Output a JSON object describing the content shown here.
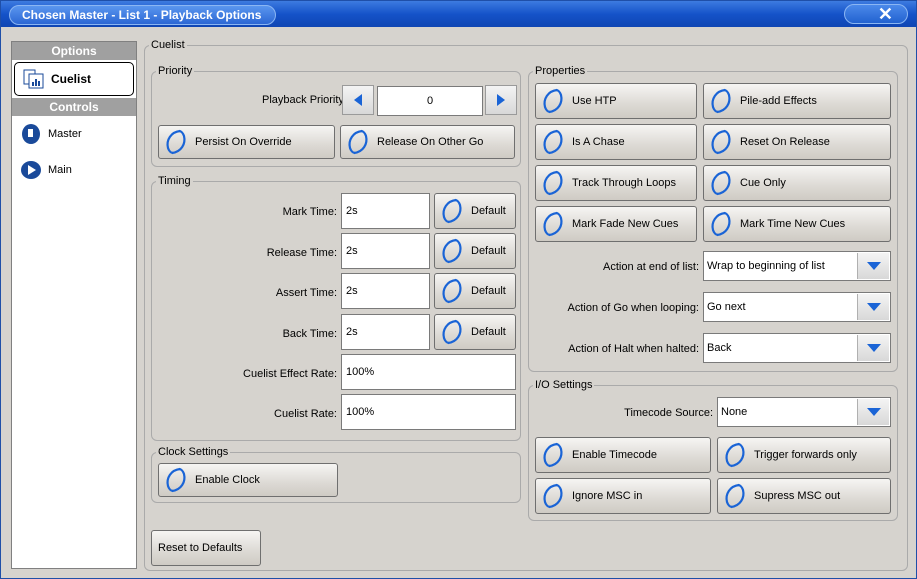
{
  "window": {
    "title": "Chosen Master - List 1 - Playback Options",
    "close_glyph": "✕"
  },
  "sidebar": {
    "options_header": "Options",
    "controls_header": "Controls",
    "items": [
      {
        "label": "Cuelist",
        "icon": "cuelist-icon"
      },
      {
        "label": "Master",
        "icon": "master-fader-icon"
      },
      {
        "label": "Main",
        "icon": "main-playback-icon"
      }
    ]
  },
  "cuelist": {
    "legend": "Cuelist",
    "priority": {
      "legend": "Priority",
      "playback_priority_label": "Playback Priority:",
      "playback_priority_value": "0",
      "persist_on_override": "Persist On Override",
      "release_on_other_go": "Release On Other Go"
    },
    "timing": {
      "legend": "Timing",
      "mark_time_label": "Mark Time:",
      "mark_time_value": "2s",
      "release_time_label": "Release Time:",
      "release_time_value": "2s",
      "assert_time_label": "Assert Time:",
      "assert_time_value": "2s",
      "back_time_label": "Back Time:",
      "back_time_value": "2s",
      "default_label": "Default",
      "effect_rate_label": "Cuelist Effect Rate:",
      "effect_rate_value": "100%",
      "cuelist_rate_label": "Cuelist Rate:",
      "cuelist_rate_value": "100%"
    },
    "clock": {
      "legend": "Clock Settings",
      "enable_clock": "Enable Clock"
    },
    "properties": {
      "legend": "Properties",
      "use_htp": "Use HTP",
      "pile_add_effects": "Pile-add Effects",
      "is_a_chase": "Is A Chase",
      "reset_on_release": "Reset On Release",
      "track_through_loops": "Track Through Loops",
      "cue_only": "Cue Only",
      "mark_fade_new_cues": "Mark Fade New Cues",
      "mark_time_new_cues": "Mark Time New Cues",
      "action_end_label": "Action at end of list:",
      "action_end_value": "Wrap to beginning of list",
      "action_go_label": "Action of Go when looping:",
      "action_go_value": "Go next",
      "action_halt_label": "Action of Halt when halted:",
      "action_halt_value": "Back"
    },
    "io": {
      "legend": "I/O Settings",
      "timecode_source_label": "Timecode Source:",
      "timecode_source_value": "None",
      "enable_timecode": "Enable Timecode",
      "trigger_forwards_only": "Trigger forwards only",
      "ignore_msc_in": "Ignore MSC in",
      "supress_msc_out": "Supress MSC out"
    },
    "reset_defaults": "Reset to Defaults"
  },
  "colors": {
    "title_bar": "#1553c9",
    "accent_blue": "#1a64d6",
    "panel": "#d6d3ce"
  }
}
